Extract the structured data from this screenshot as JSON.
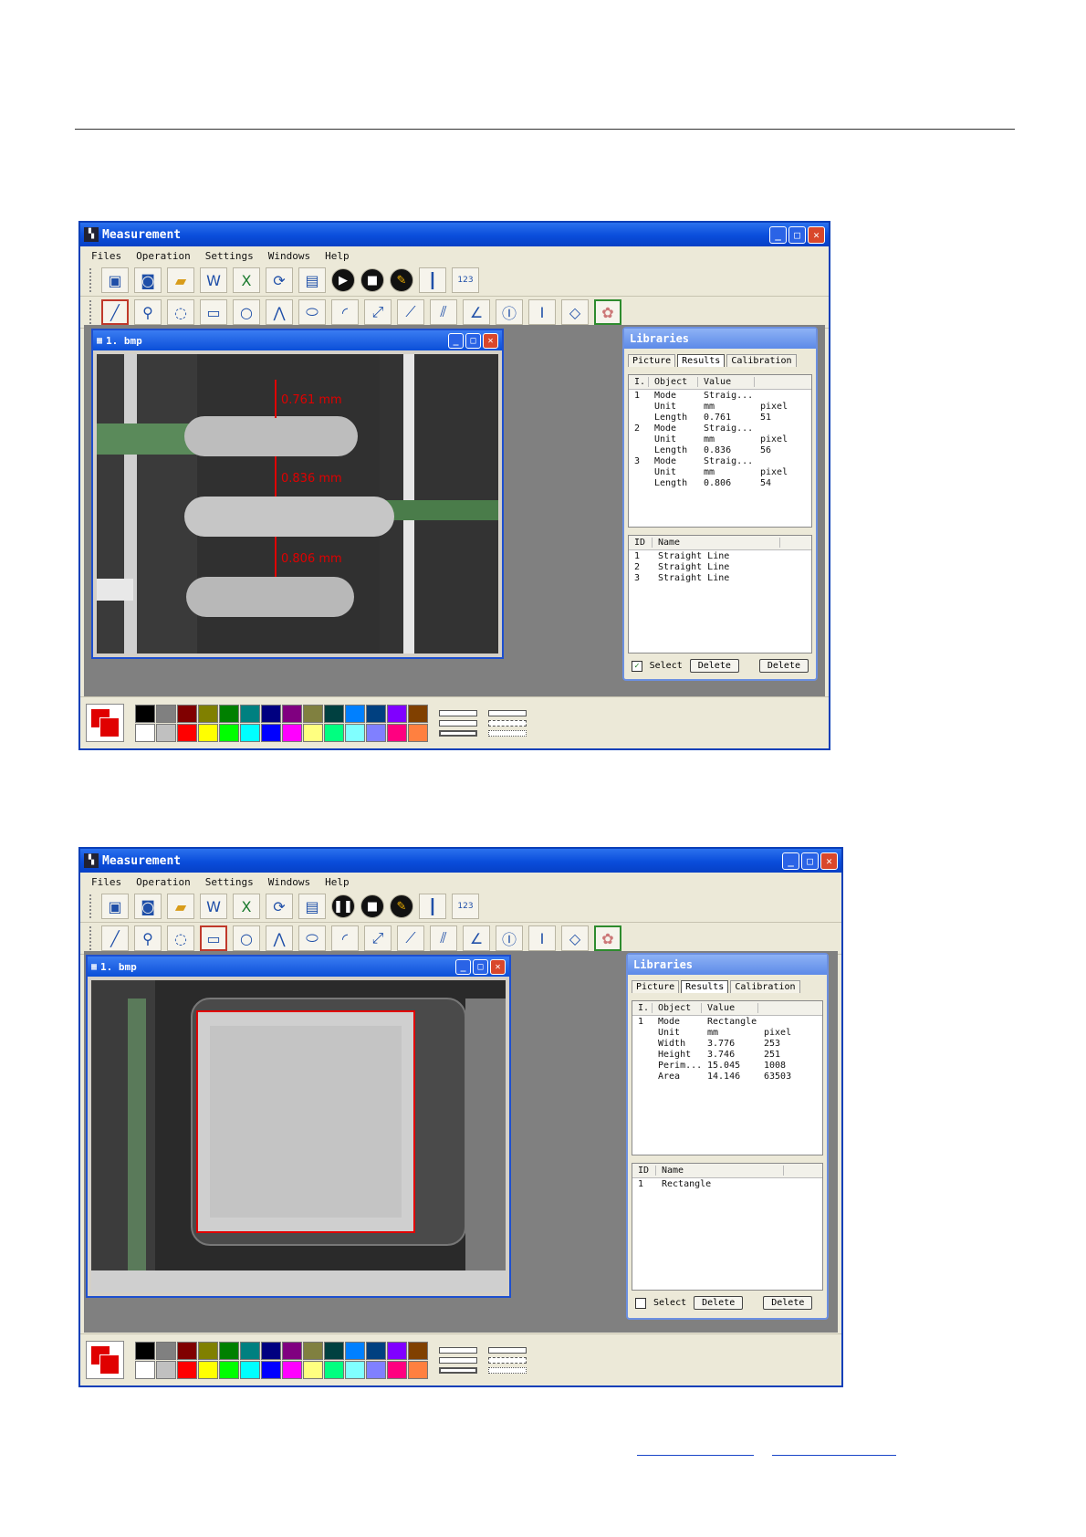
{
  "colors": {
    "title_bar": "#0a4ddb",
    "measure_line": "#e00000",
    "selection": "#e00000"
  },
  "screens": [
    {
      "window_title": "Measurement",
      "menu": [
        "Files",
        "Operation",
        "Settings",
        "Windows",
        "Help"
      ],
      "toolbar1_icons": [
        "video-icon",
        "camera-icon",
        "folder-open-icon",
        "word-export-icon",
        "excel-export-icon",
        "refresh-icon",
        "save-icon",
        "play-icon",
        "stop-icon",
        "wrench-icon",
        "ruler-icon",
        "scale-123-icon"
      ],
      "toolbar2_icons": [
        "straight-line-icon",
        "zoom-icon",
        "circle-3point-icon",
        "rectangle-icon",
        "circle-icon",
        "polyline-icon",
        "ellipse-icon",
        "arc-icon",
        "distance-icon",
        "point-line-icon",
        "parallel-lines-icon",
        "angle-icon",
        "vertical-distance-icon",
        "horizontal-distance-icon",
        "diagonal-icon",
        "palette-icon"
      ],
      "image_window_title": "1. bmp",
      "annotations": [
        "0.761 mm",
        "0.836 mm",
        "0.806 mm"
      ],
      "libraries": {
        "title": "Libraries",
        "tabs": [
          "Picture",
          "Results",
          "Calibration"
        ],
        "active_tab": "Results",
        "results_headers": [
          "I.",
          "Object",
          "Value",
          ""
        ],
        "results_rows": [
          [
            "1",
            "Mode",
            "Straig...",
            ""
          ],
          [
            "",
            "Unit",
            "mm",
            "pixel"
          ],
          [
            "",
            "Length",
            "0.761",
            "51"
          ],
          [
            "2",
            "Mode",
            "Straig...",
            ""
          ],
          [
            "",
            "Unit",
            "mm",
            "pixel"
          ],
          [
            "",
            "Length",
            "0.836",
            "56"
          ],
          [
            "3",
            "Mode",
            "Straig...",
            ""
          ],
          [
            "",
            "Unit",
            "mm",
            "pixel"
          ],
          [
            "",
            "Length",
            "0.806",
            "54"
          ]
        ],
        "name_headers": [
          "ID",
          "Name"
        ],
        "name_rows": [
          [
            "1",
            "Straight Line"
          ],
          [
            "2",
            "Straight Line"
          ],
          [
            "3",
            "Straight Line"
          ]
        ],
        "select_label": "Select",
        "select_checked": true,
        "delete_label_1": "Delete",
        "delete_label_2": "Delete"
      }
    },
    {
      "window_title": "Measurement",
      "menu": [
        "Files",
        "Operation",
        "Settings",
        "Windows",
        "Help"
      ],
      "toolbar1_icons": [
        "video-icon",
        "camera-icon",
        "folder-open-icon",
        "word-export-icon",
        "excel-export-icon",
        "refresh-icon",
        "save-icon",
        "pause-icon",
        "stop-icon",
        "wrench-icon",
        "ruler-icon",
        "scale-123-icon"
      ],
      "toolbar2_icons": [
        "straight-line-icon",
        "zoom-icon",
        "circle-3point-icon",
        "rectangle-icon",
        "circle-icon",
        "polyline-icon",
        "ellipse-icon",
        "arc-icon",
        "distance-icon",
        "point-line-icon",
        "parallel-lines-icon",
        "angle-icon",
        "vertical-distance-icon",
        "horizontal-distance-icon",
        "diagonal-icon",
        "palette-icon"
      ],
      "image_window_title": "1. bmp",
      "libraries": {
        "title": "Libraries",
        "tabs": [
          "Picture",
          "Results",
          "Calibration"
        ],
        "active_tab": "Results",
        "results_headers": [
          "I.",
          "Object",
          "Value",
          ""
        ],
        "results_rows": [
          [
            "1",
            "Mode",
            "Rectangle",
            ""
          ],
          [
            "",
            "Unit",
            "mm",
            "pixel"
          ],
          [
            "",
            "Width",
            "3.776",
            "253"
          ],
          [
            "",
            "Height",
            "3.746",
            "251"
          ],
          [
            "",
            "Perim...",
            "15.045",
            "1008"
          ],
          [
            "",
            "Area",
            "14.146",
            "63503"
          ]
        ],
        "name_headers": [
          "ID",
          "Name"
        ],
        "name_rows": [
          [
            "1",
            "Rectangle"
          ]
        ],
        "select_label": "Select",
        "select_checked": false,
        "delete_label_1": "Delete",
        "delete_label_2": "Delete"
      }
    }
  ],
  "swatches": {
    "top": [
      "#000000",
      "#808080",
      "#800000",
      "#808000",
      "#008000",
      "#008080",
      "#000080",
      "#800080",
      "#808040",
      "#004040",
      "#0080ff",
      "#004080",
      "#8000ff",
      "#804000"
    ],
    "bottom": [
      "#ffffff",
      "#c0c0c0",
      "#ff0000",
      "#ffff00",
      "#00ff00",
      "#00ffff",
      "#0000ff",
      "#ff00ff",
      "#ffff80",
      "#00ff80",
      "#80ffff",
      "#8080ff",
      "#ff0080",
      "#ff8040"
    ]
  }
}
